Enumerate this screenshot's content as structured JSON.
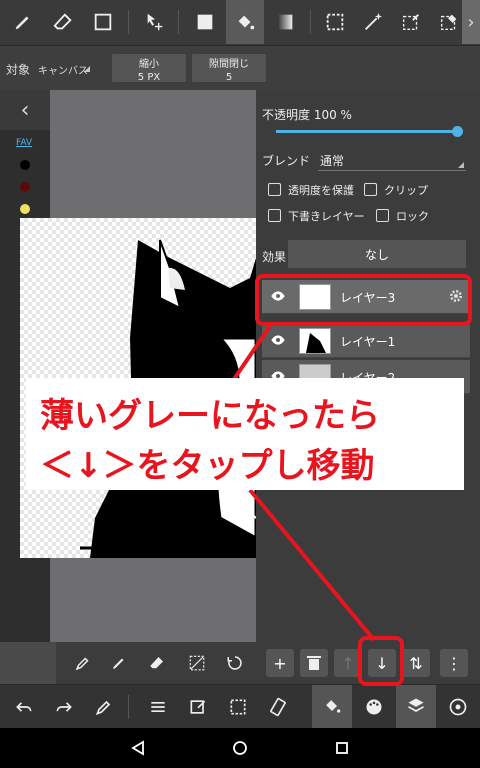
{
  "toolbar": {
    "tools": [
      "pen-icon",
      "eraser-icon",
      "rectangle-icon",
      "move-icon",
      "fill-square-icon",
      "bucket-icon",
      "gradient-icon",
      "select-rect-icon",
      "magic-wand-icon",
      "select-pen-icon",
      "select-eraser-icon"
    ],
    "more": "›"
  },
  "subbar": {
    "target_label": "対象",
    "target_value": "キャンバス",
    "shrink_label": "縮小",
    "shrink_value": "5 PX",
    "gap_label": "隙間閉じ",
    "gap_value": "5"
  },
  "leftbar": {
    "back": "‹",
    "fav": "FAV",
    "swatches": [
      "#000000",
      "#5a0a0a",
      "#f0e060",
      "#d09060",
      "#ffffff",
      "#7fd8e8",
      "#f0c890",
      "#d03020",
      "#f0a870",
      "#a0a0a0",
      "#c05020",
      "#e03050",
      "#d02080",
      "#9030a0",
      "#2040a0"
    ]
  },
  "panel": {
    "opacity_label": "不透明度 100 %",
    "opacity_value": 1.0,
    "blend_label": "ブレンド",
    "blend_value": "通常",
    "protect_label": "透明度を保護",
    "clip_label": "クリップ",
    "draft_label": "下書きレイヤー",
    "lock_label": "ロック",
    "effect_label": "効果",
    "effect_value": "なし",
    "layers": [
      {
        "name": "レイヤー3"
      },
      {
        "name": "レイヤー1"
      },
      {
        "name": "レイヤー2"
      }
    ]
  },
  "panelbar": {
    "add": "+",
    "delete": "🗑",
    "up": "↑",
    "down": "↓",
    "swap": "⇅",
    "more": "⋮"
  },
  "annotation": {
    "line1": "薄いグレーになったら",
    "line2": "＜↓＞をタップし移動"
  },
  "colors": {
    "accent": "#4fb3e8",
    "annotation_red": "#e8141e"
  }
}
